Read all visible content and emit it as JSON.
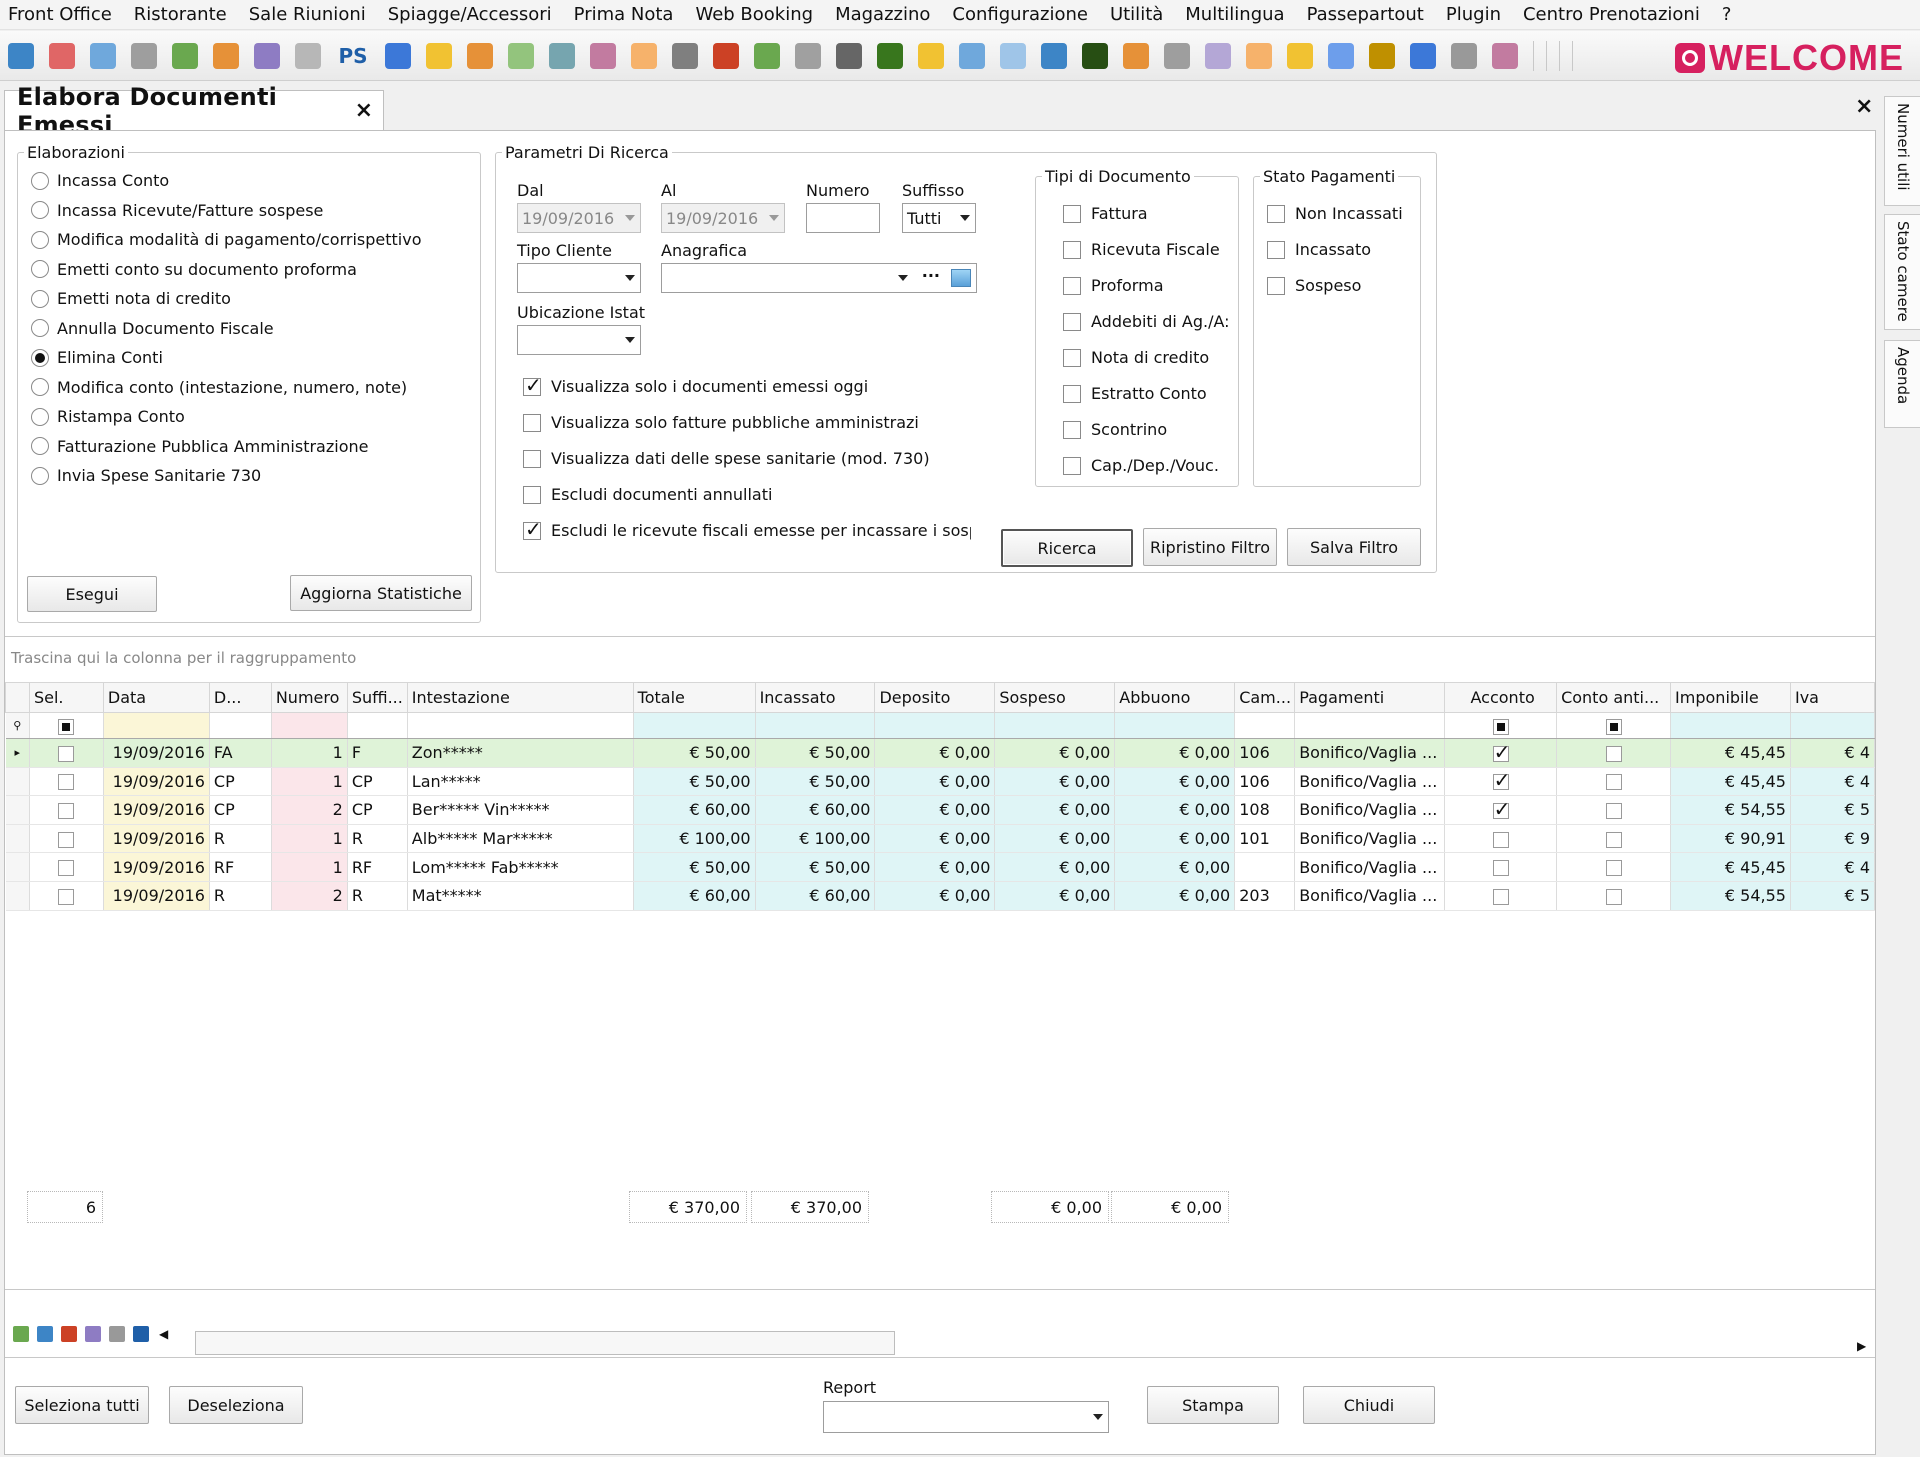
{
  "menu": [
    "Front Office",
    "Ristorante",
    "Sale Riunioni",
    "Spiagge/Accessori",
    "Prima Nota",
    "Web Booking",
    "Magazzino",
    "Configurazione",
    "Utilità",
    "Multilingua",
    "Passepartout",
    "Plugin",
    "Centro Prenotazioni",
    "?"
  ],
  "toolbar": {
    "ps_label": "PS",
    "brand": "WELCOME",
    "icons": [
      "calendar-icon",
      "planner-icon",
      "window-icon",
      "grid-icon",
      "guest-card-icon",
      "edit-icon",
      "globe-icon",
      "document-icon",
      "ps-icon",
      "user-icon",
      "users-icon",
      "document-lock-icon",
      "table-icon",
      "stack-icon",
      "keys-icon",
      "notepad-icon",
      "printer-icon",
      "cup-icon",
      "checklist-icon",
      "coffee-icon",
      "cutlery-icon",
      "add-icon",
      "pencil-icon",
      "windows-icon",
      "clock-icon",
      "chart-icon",
      "car-icon",
      "person-icon",
      "calendar-day-icon",
      "copy-icon",
      "folder-icon",
      "wallet-icon",
      "calculator-icon",
      "lock-icon",
      "help-icon",
      "gears-icon",
      "info-icon"
    ]
  },
  "tab": {
    "title": "Elabora Documenti Emessi",
    "close": "×"
  },
  "close_all": "×",
  "side_tabs": [
    "Numeri utili",
    "Stato camere",
    "Agenda"
  ],
  "elaborazioni": {
    "legend": "Elaborazioni",
    "options": [
      "Incassa Conto",
      "Incassa Ricevute/Fatture sospese",
      "Modifica modalità di pagamento/corrispettivo",
      "Emetti conto su documento proforma",
      "Emetti nota di credito",
      "Annulla Documento Fiscale",
      "Elimina Conti",
      "Modifica conto (intestazione, numero, note)",
      "Ristampa Conto",
      "Fatturazione Pubblica Amministrazione",
      "Invia Spese Sanitarie 730"
    ],
    "selected_index": 6,
    "execute": "Esegui",
    "update_stats": "Aggiorna Statistiche"
  },
  "params": {
    "legend": "Parametri Di Ricerca",
    "dal_label": "Dal",
    "dal_value": "19/09/2016",
    "al_label": "Al",
    "al_value": "19/09/2016",
    "numero_label": "Numero",
    "numero_value": "",
    "suffisso_label": "Suffisso",
    "suffisso_value": "Tutti",
    "tipo_cliente_label": "Tipo Cliente",
    "tipo_cliente_value": "",
    "anagrafica_label": "Anagrafica",
    "anagrafica_value": "",
    "anagrafica_more": "···",
    "ubicazione_label": "Ubicazione Istat",
    "ubicazione_value": "",
    "checks": [
      {
        "label": "Visualizza solo i documenti emessi oggi",
        "checked": true
      },
      {
        "label": "Visualizza solo fatture pubbliche amministrazi",
        "checked": false
      },
      {
        "label": "Visualizza dati delle spese sanitarie (mod. 730)",
        "checked": false
      },
      {
        "label": "Escludi documenti annullati",
        "checked": false
      },
      {
        "label": "Escludi le ricevute fiscali emesse per incassare i sospe:",
        "checked": true
      }
    ],
    "search": "Ricerca",
    "reset_filter": "Ripristino Filtro",
    "save_filter": "Salva Filtro"
  },
  "doc_types": {
    "legend": "Tipi di Documento",
    "items": [
      "Fattura",
      "Ricevuta Fiscale",
      "Proforma",
      "Addebiti di Ag./A:",
      "Nota di credito",
      "Estratto Conto",
      "Scontrino",
      "Cap./Dep./Vouc."
    ]
  },
  "payment_status": {
    "legend": "Stato Pagamenti",
    "items": [
      "Non Incassati",
      "Incassato",
      "Sospeso"
    ]
  },
  "grid": {
    "group_hint": "Trascina qui la colonna per il raggruppamento",
    "columns": [
      "Sel.",
      "Data",
      "D...",
      "Numero",
      "Suffi...",
      "Intestazione",
      "Totale",
      "Incassato",
      "Deposito",
      "Sospeso",
      "Abbuono",
      "Cam...",
      "Pagamenti",
      "Acconto",
      "Conto anti...",
      "Imponibile",
      "Iva"
    ],
    "rows": [
      {
        "date": "19/09/2016",
        "doc": "FA",
        "num": "1",
        "suf": "F",
        "name": "Zon*****",
        "tot": "€ 50,00",
        "inc": "€ 50,00",
        "dep": "€ 0,00",
        "sos": "€ 0,00",
        "abb": "€ 0,00",
        "cam": "106",
        "pag": "Bonifico/Vaglia ...",
        "acconto": true,
        "anti": false,
        "imp": "€ 45,45",
        "iva": "€ 4"
      },
      {
        "date": "19/09/2016",
        "doc": "CP",
        "num": "1",
        "suf": "CP",
        "name": "Lan*****",
        "tot": "€ 50,00",
        "inc": "€ 50,00",
        "dep": "€ 0,00",
        "sos": "€ 0,00",
        "abb": "€ 0,00",
        "cam": "106",
        "pag": "Bonifico/Vaglia ...",
        "acconto": true,
        "anti": false,
        "imp": "€ 45,45",
        "iva": "€ 4"
      },
      {
        "date": "19/09/2016",
        "doc": "CP",
        "num": "2",
        "suf": "CP",
        "name": "Ber***** Vin*****",
        "tot": "€ 60,00",
        "inc": "€ 60,00",
        "dep": "€ 0,00",
        "sos": "€ 0,00",
        "abb": "€ 0,00",
        "cam": "108",
        "pag": "Bonifico/Vaglia ...",
        "acconto": true,
        "anti": false,
        "imp": "€ 54,55",
        "iva": "€ 5"
      },
      {
        "date": "19/09/2016",
        "doc": "R",
        "num": "1",
        "suf": "R",
        "name": "Alb***** Mar*****",
        "tot": "€ 100,00",
        "inc": "€ 100,00",
        "dep": "€ 0,00",
        "sos": "€ 0,00",
        "abb": "€ 0,00",
        "cam": "101",
        "pag": "Bonifico/Vaglia ...",
        "acconto": false,
        "anti": false,
        "imp": "€ 90,91",
        "iva": "€ 9"
      },
      {
        "date": "19/09/2016",
        "doc": "RF",
        "num": "1",
        "suf": "RF",
        "name": "Lom***** Fab*****",
        "tot": "€ 50,00",
        "inc": "€ 50,00",
        "dep": "€ 0,00",
        "sos": "€ 0,00",
        "abb": "€ 0,00",
        "cam": "",
        "pag": "Bonifico/Vaglia ...",
        "acconto": false,
        "anti": false,
        "imp": "€ 45,45",
        "iva": "€ 4"
      },
      {
        "date": "19/09/2016",
        "doc": "R",
        "num": "2",
        "suf": "R",
        "name": "Mat*****",
        "tot": "€ 60,00",
        "inc": "€ 60,00",
        "dep": "€ 0,00",
        "sos": "€ 0,00",
        "abb": "€ 0,00",
        "cam": "203",
        "pag": "Bonifico/Vaglia ...",
        "acconto": false,
        "anti": false,
        "imp": "€ 54,55",
        "iva": "€ 5"
      }
    ],
    "footer": {
      "count": "6",
      "tot": "€ 370,00",
      "inc": "€ 370,00",
      "sos": "€ 0,00",
      "abb": "€ 0,00"
    }
  },
  "bottom": {
    "select_all": "Seleziona tutti",
    "deselect": "Deseleziona",
    "report_label": "Report",
    "report_value": "",
    "print": "Stampa",
    "close": "Chiudi"
  }
}
